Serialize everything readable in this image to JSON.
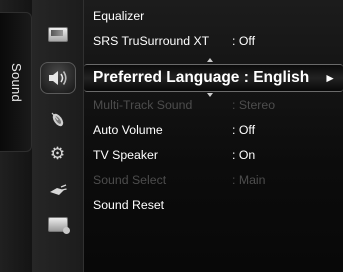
{
  "tab": {
    "label": "Sound"
  },
  "menu": {
    "items": [
      {
        "label": "Equalizer",
        "value": "",
        "enabled": true
      },
      {
        "label": "SRS TruSurround XT",
        "value": ": Off",
        "enabled": true
      },
      {
        "label": "Preferred Language : English",
        "value": "",
        "enabled": true,
        "selected": true
      },
      {
        "label": "Multi-Track Sound",
        "value": ": Stereo",
        "enabled": false
      },
      {
        "label": "Auto Volume",
        "value": ": Off",
        "enabled": true
      },
      {
        "label": "TV Speaker",
        "value": ": On",
        "enabled": true
      },
      {
        "label": "Sound Select",
        "value": ": Main",
        "enabled": false
      },
      {
        "label": "Sound Reset",
        "value": "",
        "enabled": true
      }
    ],
    "selected_arrow": "►"
  },
  "icons": {
    "picture": "picture-icon",
    "sound": "speaker-icon",
    "channel": "satellite-dish-icon",
    "setup": "gear-icon",
    "input": "input-plug-icon",
    "support": "support-icon",
    "setup_glyph": "⚙"
  },
  "colors": {
    "text": "#ffffff",
    "disabled_text": "#4d4d4d",
    "background": "#0c0c0c",
    "icon_column": "#222222"
  }
}
